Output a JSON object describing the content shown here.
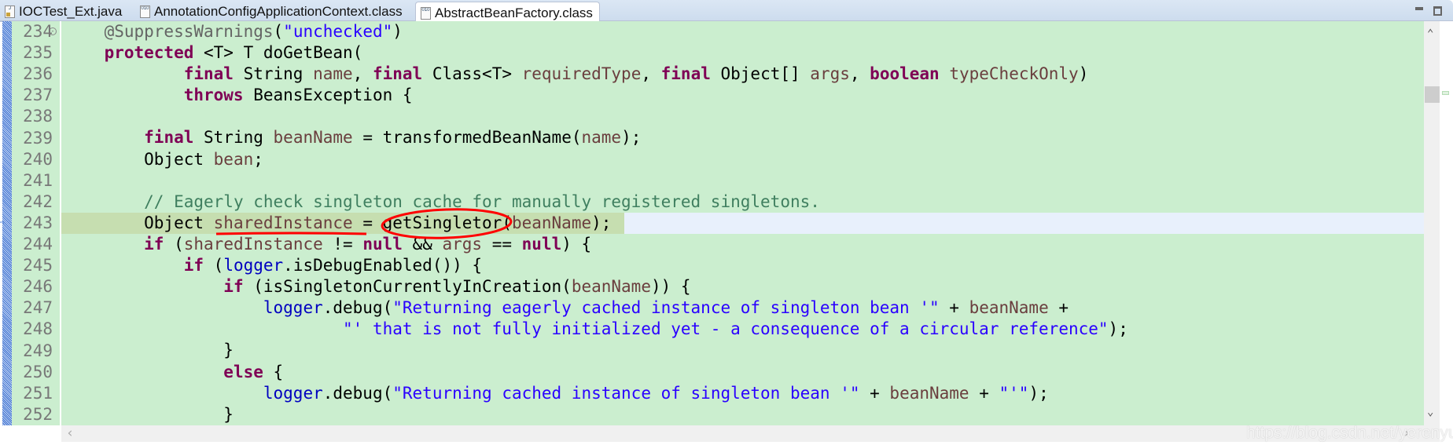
{
  "tabs": [
    {
      "label": "IOCTest_Ext.java",
      "icon": "java-file-icon",
      "active": false
    },
    {
      "label": "AnnotationConfigApplicationContext.class",
      "icon": "class-file-icon",
      "active": false
    },
    {
      "label": "AbstractBeanFactory.class",
      "icon": "class-file-icon",
      "active": true
    }
  ],
  "colors": {
    "background": "#cbeecf",
    "keyword": "#7f0055",
    "string": "#2a00ff",
    "field": "#0000c0",
    "comment": "#3f7f5f",
    "local": "#6a3e3e",
    "annotation_mark": "#ff0000"
  },
  "current_line": 243,
  "lines": [
    {
      "n": "234",
      "t": [
        [
          "    ",
          ""
        ],
        [
          "@SuppressWarnings",
          "ann"
        ],
        [
          "(",
          ""
        ],
        [
          "\"unchecked\"",
          "str"
        ],
        [
          ")",
          ""
        ]
      ]
    },
    {
      "n": "235",
      "t": [
        [
          "    ",
          ""
        ],
        [
          "protected",
          "kw"
        ],
        [
          " <T> T doGetBean(",
          ""
        ]
      ]
    },
    {
      "n": "236",
      "t": [
        [
          "            ",
          ""
        ],
        [
          "final",
          "kw"
        ],
        [
          " String ",
          ""
        ],
        [
          "name",
          "var"
        ],
        [
          ", ",
          ""
        ],
        [
          "final",
          "kw"
        ],
        [
          " Class<T> ",
          ""
        ],
        [
          "requiredType",
          "var"
        ],
        [
          ", ",
          ""
        ],
        [
          "final",
          "kw"
        ],
        [
          " Object[] ",
          ""
        ],
        [
          "args",
          "var"
        ],
        [
          ", ",
          ""
        ],
        [
          "boolean",
          "kw"
        ],
        [
          " ",
          ""
        ],
        [
          "typeCheckOnly",
          "var"
        ],
        [
          ")",
          ""
        ]
      ]
    },
    {
      "n": "237",
      "t": [
        [
          "            ",
          ""
        ],
        [
          "throws",
          "kw"
        ],
        [
          " BeansException {",
          ""
        ]
      ]
    },
    {
      "n": "238",
      "t": []
    },
    {
      "n": "239",
      "t": [
        [
          "        ",
          ""
        ],
        [
          "final",
          "kw"
        ],
        [
          " String ",
          ""
        ],
        [
          "beanName",
          "var"
        ],
        [
          " = transformedBeanName(",
          ""
        ],
        [
          "name",
          "var"
        ],
        [
          ");",
          ""
        ]
      ]
    },
    {
      "n": "240",
      "t": [
        [
          "        Object ",
          ""
        ],
        [
          "bean",
          "var"
        ],
        [
          ";",
          ""
        ]
      ]
    },
    {
      "n": "241",
      "t": []
    },
    {
      "n": "242",
      "t": [
        [
          "        ",
          ""
        ],
        [
          "// Eagerly check singleton cache for manually registered singletons.",
          "cmt"
        ]
      ]
    },
    {
      "n": "243",
      "t": [
        [
          "        Object ",
          ""
        ],
        [
          "sharedInstance",
          "var"
        ],
        [
          " = getSingletor(",
          ""
        ],
        [
          "beanName",
          "var"
        ],
        [
          ");",
          ""
        ]
      ]
    },
    {
      "n": "244",
      "t": [
        [
          "        ",
          ""
        ],
        [
          "if",
          "kw"
        ],
        [
          " (",
          ""
        ],
        [
          "sharedInstance",
          "var"
        ],
        [
          " != ",
          ""
        ],
        [
          "null",
          "kw"
        ],
        [
          " && ",
          ""
        ],
        [
          "args",
          "var"
        ],
        [
          " == ",
          ""
        ],
        [
          "null",
          "kw"
        ],
        [
          ") {",
          ""
        ]
      ]
    },
    {
      "n": "245",
      "t": [
        [
          "            ",
          ""
        ],
        [
          "if",
          "kw"
        ],
        [
          " (",
          ""
        ],
        [
          "logger",
          "fld"
        ],
        [
          ".isDebugEnabled()) {",
          ""
        ]
      ]
    },
    {
      "n": "246",
      "t": [
        [
          "                ",
          ""
        ],
        [
          "if",
          "kw"
        ],
        [
          " (isSingletonCurrentlyInCreation(",
          ""
        ],
        [
          "beanName",
          "var"
        ],
        [
          ")) {",
          ""
        ]
      ]
    },
    {
      "n": "247",
      "t": [
        [
          "                    ",
          ""
        ],
        [
          "logger",
          "fld"
        ],
        [
          ".debug(",
          ""
        ],
        [
          "\"Returning eagerly cached instance of singleton bean '\"",
          "str"
        ],
        [
          " + ",
          ""
        ],
        [
          "beanName",
          "var"
        ],
        [
          " +",
          ""
        ]
      ]
    },
    {
      "n": "248",
      "t": [
        [
          "                            ",
          ""
        ],
        [
          "\"' that is not fully initialized yet - a consequence of a circular reference\"",
          "str"
        ],
        [
          ");",
          ""
        ]
      ]
    },
    {
      "n": "249",
      "t": [
        [
          "                }",
          ""
        ]
      ]
    },
    {
      "n": "250",
      "t": [
        [
          "                ",
          ""
        ],
        [
          "else",
          "kw"
        ],
        [
          " {",
          ""
        ]
      ]
    },
    {
      "n": "251",
      "t": [
        [
          "                    ",
          ""
        ],
        [
          "logger",
          "fld"
        ],
        [
          ".debug(",
          ""
        ],
        [
          "\"Returning cached instance of singleton bean '\"",
          "str"
        ],
        [
          " + ",
          ""
        ],
        [
          "beanName",
          "var"
        ],
        [
          " + ",
          ""
        ],
        [
          "\"'\"",
          "str"
        ],
        [
          ");",
          ""
        ]
      ]
    },
    {
      "n": "252",
      "t": [
        [
          "                }",
          ""
        ]
      ]
    }
  ],
  "watermark": "https://blog.csdn.net/yerenyuan_pku"
}
